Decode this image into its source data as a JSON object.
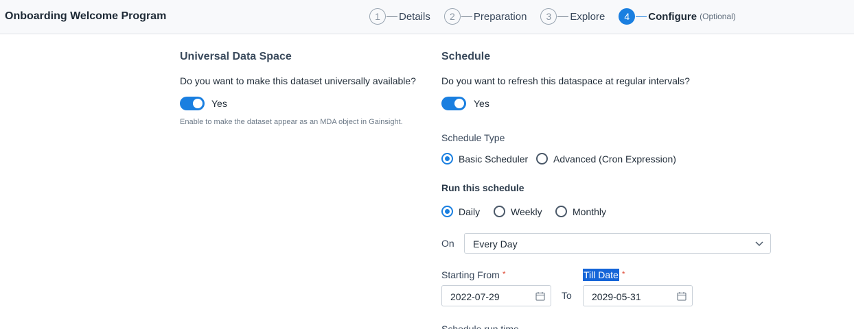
{
  "header": {
    "title": "Onboarding Welcome Program",
    "steps": [
      {
        "number": "1",
        "label": "Details"
      },
      {
        "number": "2",
        "label": "Preparation"
      },
      {
        "number": "3",
        "label": "Explore"
      },
      {
        "number": "4",
        "label": "Configure",
        "optional": "(Optional)"
      }
    ]
  },
  "universal": {
    "title": "Universal Data Space",
    "question": "Do you want to make this dataset universally available?",
    "toggle_label": "Yes",
    "hint": "Enable to make the dataset appear as an MDA object in Gainsight."
  },
  "schedule": {
    "title": "Schedule",
    "question": "Do you want to refresh this dataspace at regular intervals?",
    "toggle_label": "Yes",
    "type_label": "Schedule Type",
    "type_options": [
      "Basic Scheduler",
      "Advanced (Cron Expression)"
    ],
    "run_label": "Run this schedule",
    "run_options": [
      "Daily",
      "Weekly",
      "Monthly"
    ],
    "on_label": "On",
    "on_value": "Every Day",
    "starting_label": "Starting From",
    "starting_value": "2022-07-29",
    "to_label": "To",
    "till_label": "Till Date",
    "till_value": "2029-05-31",
    "required_mark": "*",
    "runtime_label": "Schedule run time"
  },
  "colors": {
    "accent": "#1a7fe0",
    "required": "#e0503c"
  }
}
